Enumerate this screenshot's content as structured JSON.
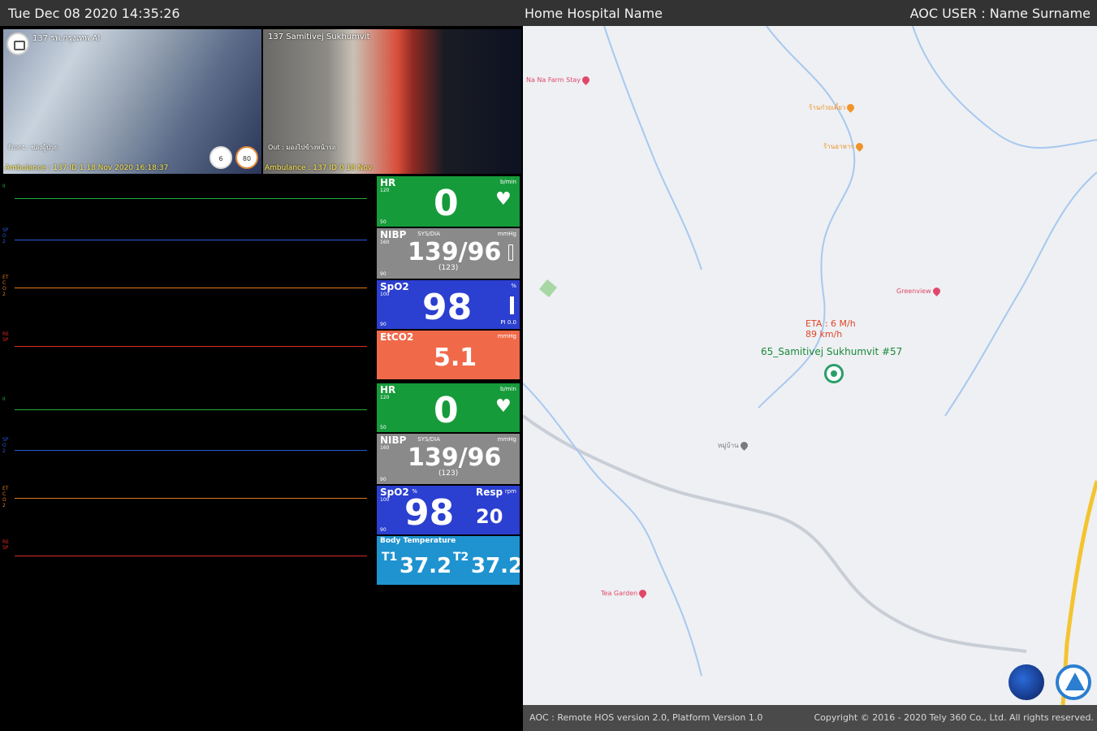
{
  "header": {
    "datetime": "Tue Dec 08 2020 14:35:26",
    "hospital": "Home Hospital Name",
    "user": "AOC USER : Name Surname"
  },
  "videos": [
    {
      "title": "137 รพ.กรุงเทพ AI",
      "location": "Front : ช่องผู้ป่วย",
      "footer": "Ambulance : 137 ID 1 18 Nov 2020 16:18:37",
      "badges": [
        "6 km/h",
        "80 km/h"
      ]
    },
    {
      "title": "137 Samitivej Sukhumvit",
      "location": "Out : มองไปข้างหน้ารถ",
      "footer": "Ambulance : 137 ID 0 18 Nov"
    }
  ],
  "waves": [
    {
      "label": "II",
      "color": "#1fae3a"
    },
    {
      "label": "SPO2",
      "color": "#2a58d8"
    },
    {
      "label": "ETCO2",
      "color": "#e0781e"
    },
    {
      "label": "RESP",
      "color": "#d82a2a"
    },
    {
      "label": "II",
      "color": "#1fae3a"
    },
    {
      "label": "SPO2",
      "color": "#2a58d8"
    },
    {
      "label": "ETCO2",
      "color": "#e0781e"
    },
    {
      "label": "RESP",
      "color": "#d82a2a"
    }
  ],
  "monitor1": {
    "hr": {
      "label": "HR",
      "unit": "b/min",
      "hi": "120",
      "lo": "50",
      "value": "0"
    },
    "nibp": {
      "label": "NIBP",
      "sub": "SYS/DIA",
      "mode": "mmHg",
      "hi": "160",
      "lo": "90",
      "value": "139/96",
      "mean": "(123)"
    },
    "spo2": {
      "label": "SpO2",
      "unit": "%",
      "hi": "100",
      "lo": "90",
      "value": "98",
      "pi": "PI 0.0"
    },
    "etco2": {
      "label": "EtCO2",
      "unit": "mmHg",
      "value": "5.1"
    }
  },
  "monitor2": {
    "hr": {
      "label": "HR",
      "unit": "b/min",
      "hi": "120",
      "lo": "50",
      "value": "0"
    },
    "nibp": {
      "label": "NIBP",
      "sub": "SYS/DIA",
      "mode": "mmHg",
      "hi": "160",
      "lo": "90",
      "value": "139/96",
      "mean": "(123)"
    },
    "spo2": {
      "label": "SpO2",
      "unit": "%",
      "hi": "100",
      "lo": "90",
      "value": "98"
    },
    "resp": {
      "label": "Resp",
      "unit": "rpm",
      "value": "20"
    },
    "temp": {
      "label": "Body Temperature",
      "t1_label": "T1",
      "t1": "37.2",
      "t2_label": "T2",
      "t2": "37.2"
    }
  },
  "map": {
    "vehicle_speed": "6 M/h",
    "vehicle_speed_prefix": "ETA : ",
    "vehicle_speed2": "89 km/h",
    "vehicle_name": "65_Samitivej Sukhumvit #57",
    "pois": [
      {
        "name": "Na Na Farm Stay",
        "color": "#e0486a"
      },
      {
        "name": "ร้านก๋วยเตี๋ยว",
        "color": "#f0932a"
      },
      {
        "name": "ร้านอาหาร",
        "color": "#f0932a"
      },
      {
        "name": "Greenview",
        "color": "#e0486a"
      },
      {
        "name": "หมู่บ้าน",
        "color": "#7a7a7a"
      },
      {
        "name": "Tea Garden",
        "color": "#e0486a"
      }
    ]
  },
  "footer": {
    "left": "AOC : Remote HOS version 2.0, Platform Version 1.0",
    "right": "Copyright © 2016 - 2020 Tely 360 Co., Ltd. All rights reserved."
  }
}
